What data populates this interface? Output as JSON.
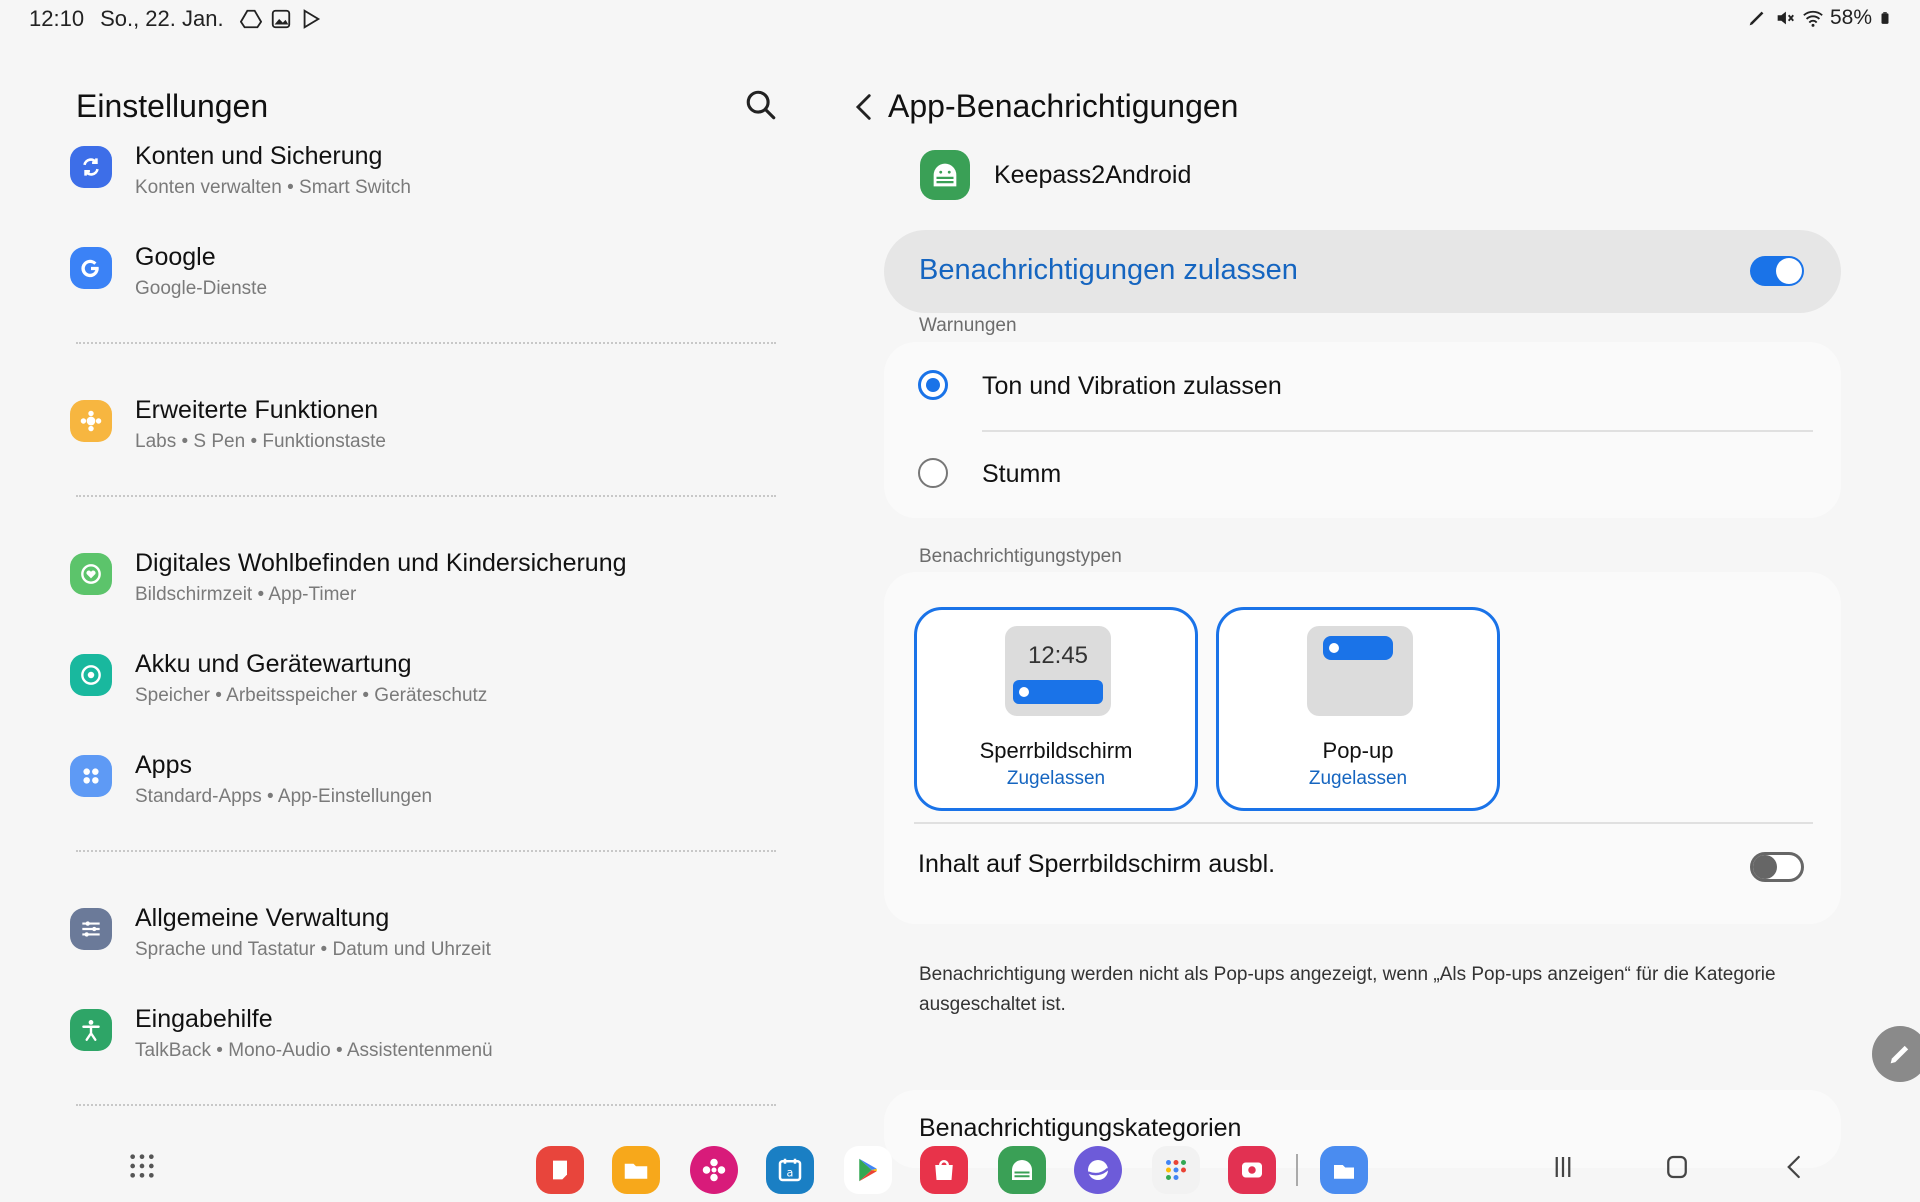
{
  "status_bar": {
    "time": "12:10",
    "date": "So., 22. Jan.",
    "battery": "58%",
    "left_icons": [
      "drive-icon",
      "gallery-icon",
      "play-icon"
    ],
    "right_icons": [
      "pen-icon",
      "mute-icon",
      "wifi-icon",
      "battery-icon"
    ]
  },
  "left_pane": {
    "title": "Einstellungen",
    "items": [
      {
        "title": "Konten und Sicherung",
        "subtitle": "Konten verwalten  •  Smart Switch",
        "icon": "sync-icon",
        "color": "#3d6ee8"
      },
      {
        "title": "Google",
        "subtitle": "Google-Dienste",
        "icon": "google-icon",
        "color": "#3b82f6"
      },
      {
        "title": "Erweiterte Funktionen",
        "subtitle": "Labs  •  S Pen  •  Funktionstaste",
        "icon": "puzzle-icon",
        "color": "#f7b640"
      },
      {
        "title": "Digitales Wohlbefinden und Kindersicherung",
        "subtitle": "Bildschirmzeit  •  App-Timer",
        "icon": "wellbeing-icon",
        "color": "#5cc46b"
      },
      {
        "title": "Akku und Gerätewartung",
        "subtitle": "Speicher  •  Arbeitsspeicher  •  Geräteschutz",
        "icon": "battery-care-icon",
        "color": "#19b89e"
      },
      {
        "title": "Apps",
        "subtitle": "Standard-Apps  •  App-Einstellungen",
        "icon": "apps-icon",
        "color": "#5e9af5"
      },
      {
        "title": "Allgemeine Verwaltung",
        "subtitle": "Sprache und Tastatur  •  Datum und Uhrzeit",
        "icon": "sliders-icon",
        "color": "#6b7a99"
      },
      {
        "title": "Eingabehilfe",
        "subtitle": "TalkBack  •  Mono-Audio  •  Assistentenmenü",
        "icon": "accessibility-icon",
        "color": "#2ea567"
      }
    ]
  },
  "right_pane": {
    "title": "App-Benachrichtigungen",
    "app_name": "Keepass2Android",
    "allow_label": "Benachrichtigungen zulassen",
    "allow_on": true,
    "warnings_header": "Warnungen",
    "warnings": [
      {
        "label": "Ton und Vibration zulassen",
        "selected": true
      },
      {
        "label": "Stumm",
        "selected": false
      }
    ],
    "types_header": "Benachrichtigungstypen",
    "types": [
      {
        "name": "Sperrbildschirm",
        "status": "Zugelassen",
        "preview_time": "12:45"
      },
      {
        "name": "Pop-up",
        "status": "Zugelassen"
      }
    ],
    "hide_content_label": "Inhalt auf Sperrbildschirm ausbl.",
    "hide_content_on": false,
    "note": "Benachrichtigung werden nicht als Pop-ups angezeigt, wenn „Als Pop-ups anzeigen“ für die Kategorie ausgeschaltet ist.",
    "categories_label": "Benachrichtigungskategorien"
  },
  "taskbar": {
    "apps": [
      {
        "name": "notes-app-icon",
        "color": "#e8453c"
      },
      {
        "name": "files-app-icon",
        "color": "#f7a81b"
      },
      {
        "name": "flower-app-icon",
        "color": "#d81b7a"
      },
      {
        "name": "calendar-app-icon",
        "color": "#1a7fc4"
      },
      {
        "name": "play-store-icon",
        "color": "#ffffff"
      },
      {
        "name": "galaxy-store-icon",
        "color": "#e8334a"
      },
      {
        "name": "keepass-app-icon",
        "color": "#3aa056"
      },
      {
        "name": "internet-app-icon",
        "color": "#6d5bd9"
      },
      {
        "name": "google-folder-icon",
        "color": "#f2f2f2"
      },
      {
        "name": "screen-recorder-icon",
        "color": "#e23152"
      },
      {
        "name": "my-files-app-icon",
        "color": "#4a8cf0"
      }
    ]
  }
}
